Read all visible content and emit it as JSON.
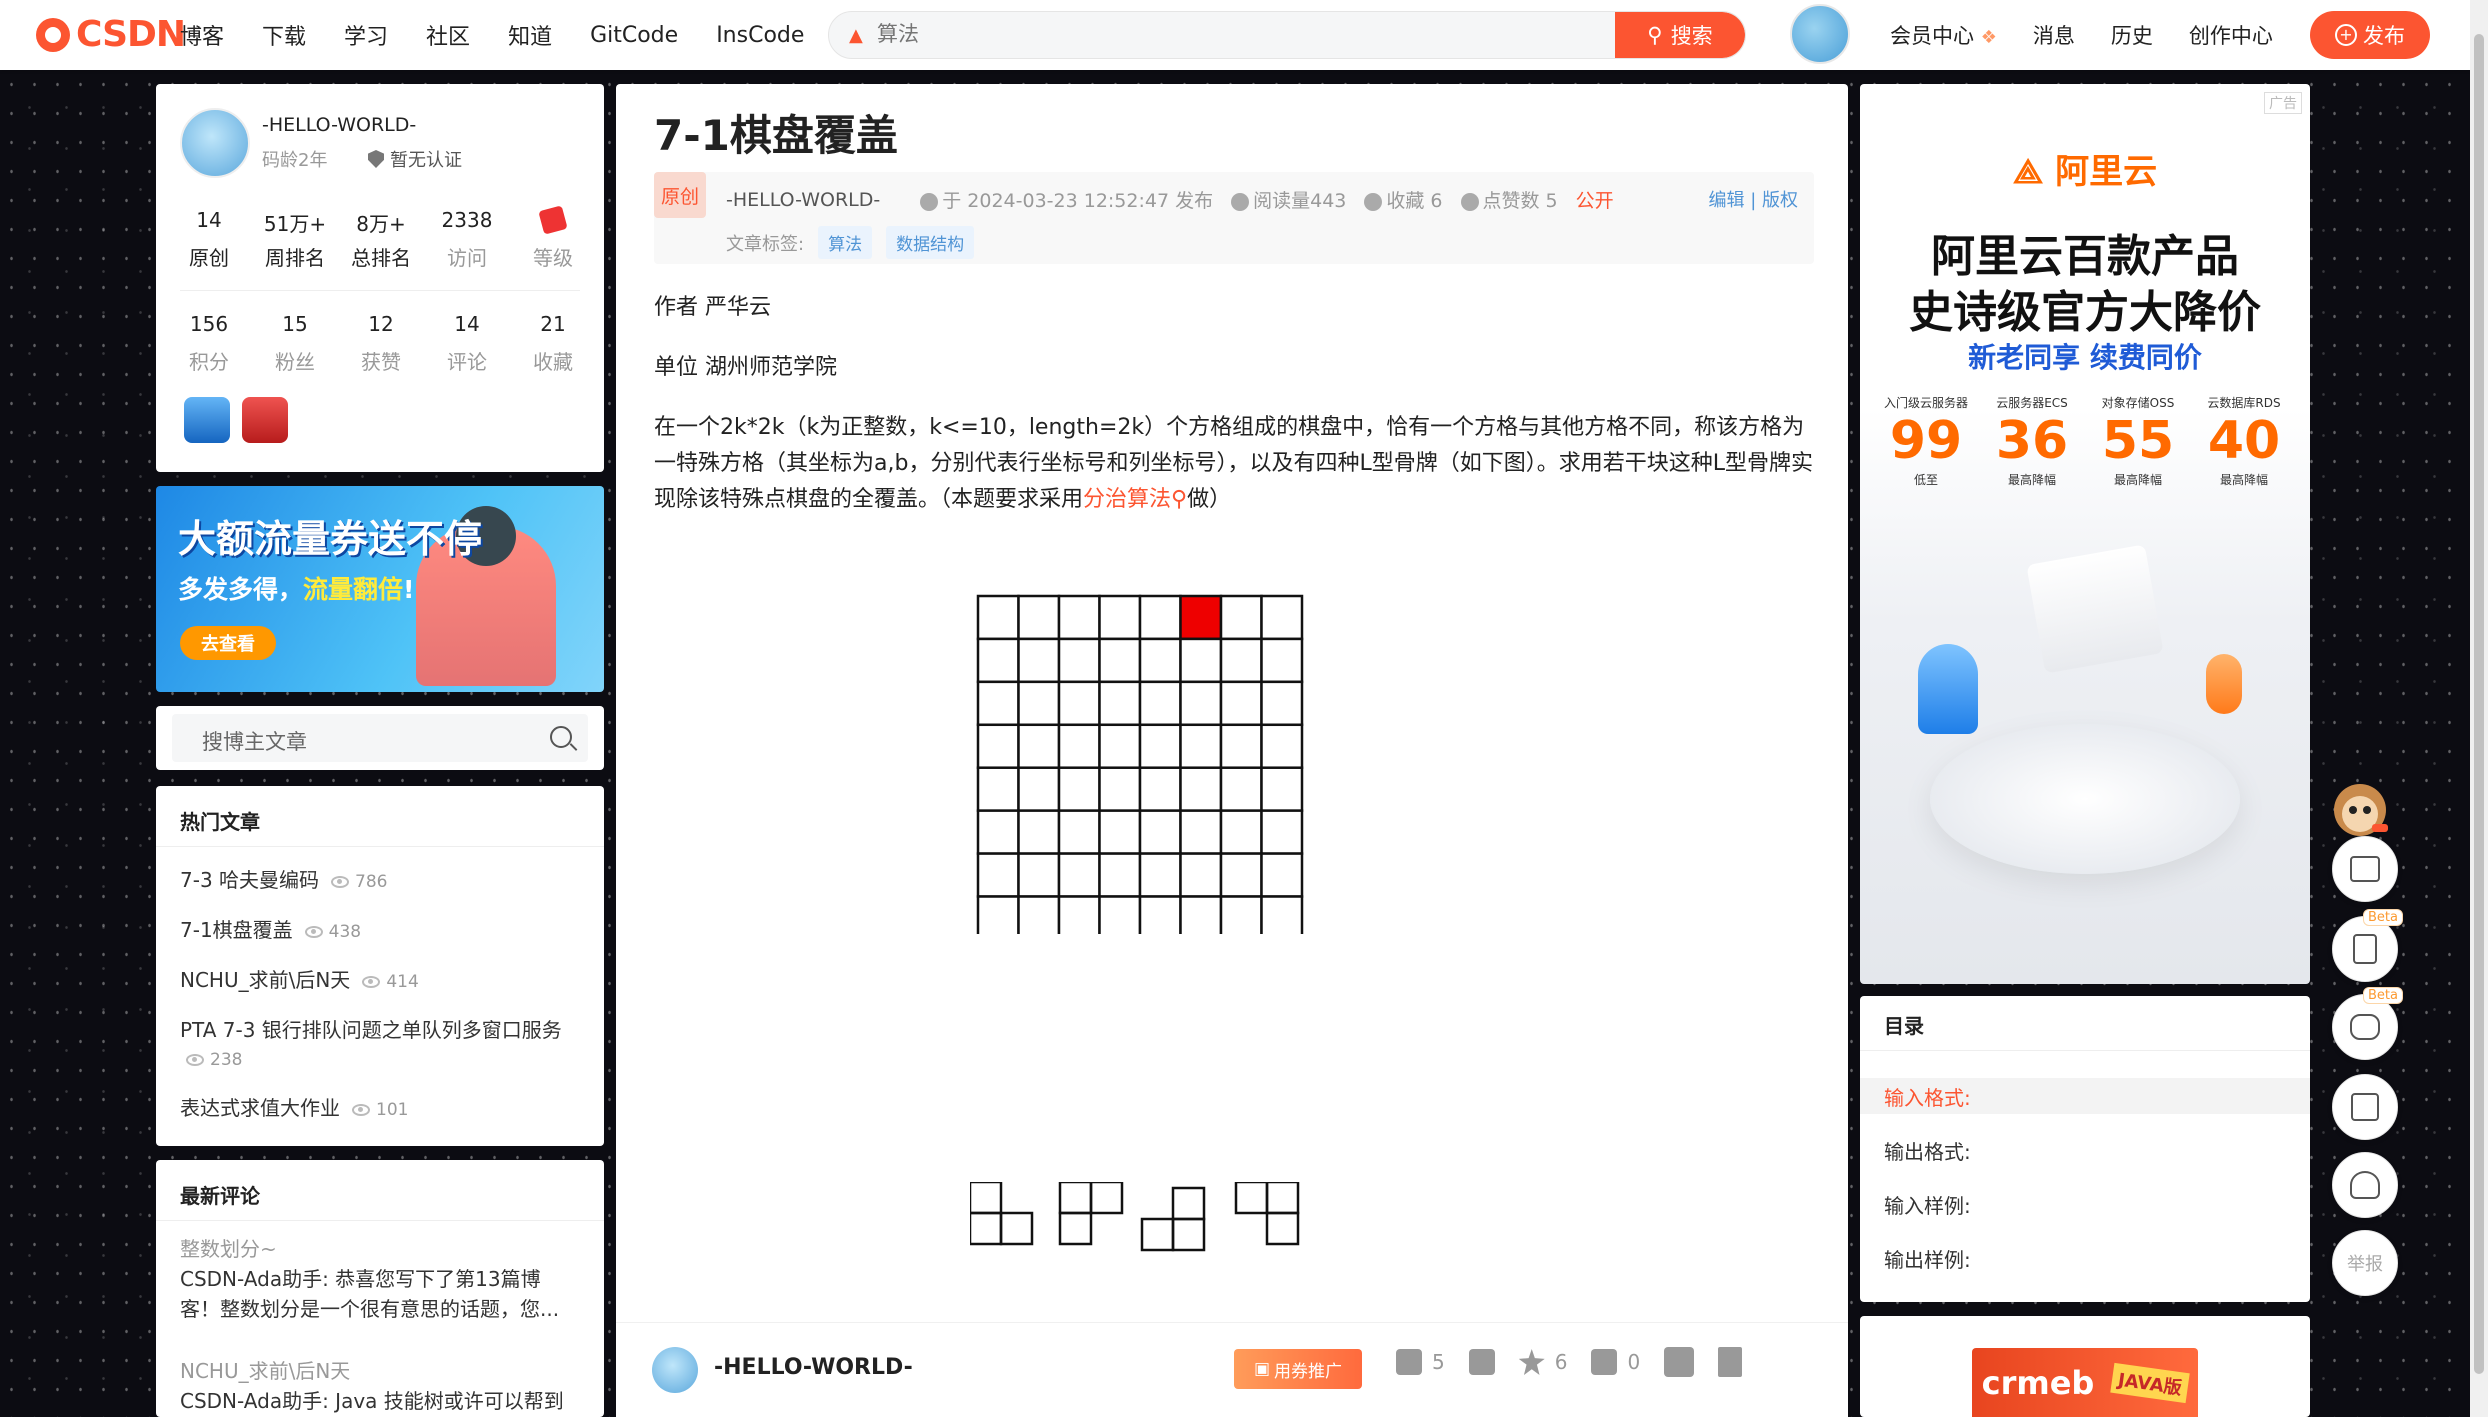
{
  "topbar": {
    "logo_text": "CSDN",
    "nav": [
      "博客",
      "下载",
      "学习",
      "社区",
      "知道",
      "GitCode",
      "InsCode"
    ],
    "search_placeholder": "算法",
    "search_button": "搜索",
    "right_nav": [
      "会员中心",
      "消息",
      "历史",
      "创作中心"
    ],
    "publish": "发布"
  },
  "profile": {
    "name": "-HELLO-WORLD-",
    "age": "码龄2年",
    "cert": "暂无认证",
    "stats_row1": [
      {
        "num": "14",
        "label": "原创"
      },
      {
        "num": "51万+",
        "label": "周排名"
      },
      {
        "num": "8万+",
        "label": "总排名"
      },
      {
        "num": "2338",
        "label": "访问"
      },
      {
        "num": "",
        "label": "等级"
      }
    ],
    "stats_row2": [
      {
        "num": "156",
        "label": "积分"
      },
      {
        "num": "15",
        "label": "粉丝"
      },
      {
        "num": "12",
        "label": "获赞"
      },
      {
        "num": "14",
        "label": "评论"
      },
      {
        "num": "21",
        "label": "收藏"
      }
    ]
  },
  "banner": {
    "title": "大额流量券送不停",
    "sub_a": "多发多得，",
    "sub_b": "流量翻倍",
    "sub_c": "!",
    "button": "去查看"
  },
  "blog_search": {
    "placeholder": "搜博主文章"
  },
  "hot": {
    "title": "热门文章",
    "items": [
      {
        "title": "7-3 哈夫曼编码",
        "views": "786"
      },
      {
        "title": "7-1棋盘覆盖",
        "views": "438"
      },
      {
        "title": "NCHU_求前\\后N天",
        "views": "414"
      },
      {
        "title": "PTA 7-3 银行排队问题之单队列多窗口服务",
        "views": "238"
      },
      {
        "title": "表达式求值大作业",
        "views": "101"
      }
    ]
  },
  "comments": {
    "title": "最新评论",
    "items": [
      {
        "article": "整数划分~",
        "text1": "CSDN-Ada助手: 恭喜您写下了第13篇博",
        "text2": "客！整数划分是一个很有意思的话题，您..."
      },
      {
        "article": "NCHU_求前\\后N天",
        "text1": "CSDN-Ada助手: Java 技能树或许可以帮到"
      }
    ]
  },
  "article": {
    "title": "7-1棋盘覆盖",
    "original": "原创",
    "author": "-HELLO-WORLD-",
    "date": "于 2024-03-23 12:52:47 发布",
    "views": "阅读量443",
    "favorites": "收藏 6",
    "likes": "点赞数 5",
    "visibility": "公开",
    "edit": "编辑",
    "copyright": "版权",
    "tags_label": "文章标签:",
    "tags": [
      "算法",
      "数据结构"
    ],
    "author_line": "作者 严华云",
    "unit_line": "单位 湖州师范学院",
    "para": "在一个2k*2k（k为正整数，k<=10，length=2k）个方格组成的棋盘中，恰有一个方格与其他方格不同，称该方格为一特殊方格（其坐标为a,b，分别代表行坐标号和列坐标号），以及有四种L型骨牌（如下图）。求用若干块这种L型骨牌实现除该特殊点棋盘的全覆盖。（本题要求采用",
    "para_link": "分治算法",
    "para_end": "做）",
    "board": {
      "rows": 8,
      "cols": 8,
      "special_row": 0,
      "special_col": 5,
      "special_color": "#ee0000"
    }
  },
  "bottom": {
    "author": "-HELLO-WORLD-",
    "promo": "用券推广",
    "likes": "5",
    "stars": "6",
    "comments": "0"
  },
  "ad": {
    "label": "广告",
    "brand": "阿里云",
    "h1": "阿里云百款产品",
    "h2": "史诗级官方大降价",
    "h3": "新老同享 续费同价",
    "cols": [
      {
        "label": "入门级云服务器",
        "value": "99",
        "sub": "低至"
      },
      {
        "label": "云服务器ECS",
        "value": "36",
        "sub": "最高降幅"
      },
      {
        "label": "对象存储OSS",
        "value": "55",
        "sub": "最高降幅"
      },
      {
        "label": "云数据库RDS",
        "value": "40",
        "sub": "最高降幅"
      }
    ]
  },
  "toc": {
    "title": "目录",
    "items": [
      "输入格式:",
      "输出格式:",
      "输入样例:",
      "输出样例:"
    ]
  },
  "adbot": {
    "brand": "crmeb",
    "tag": "JAVA版"
  },
  "float": {
    "beta": "Beta",
    "report": "举报"
  }
}
